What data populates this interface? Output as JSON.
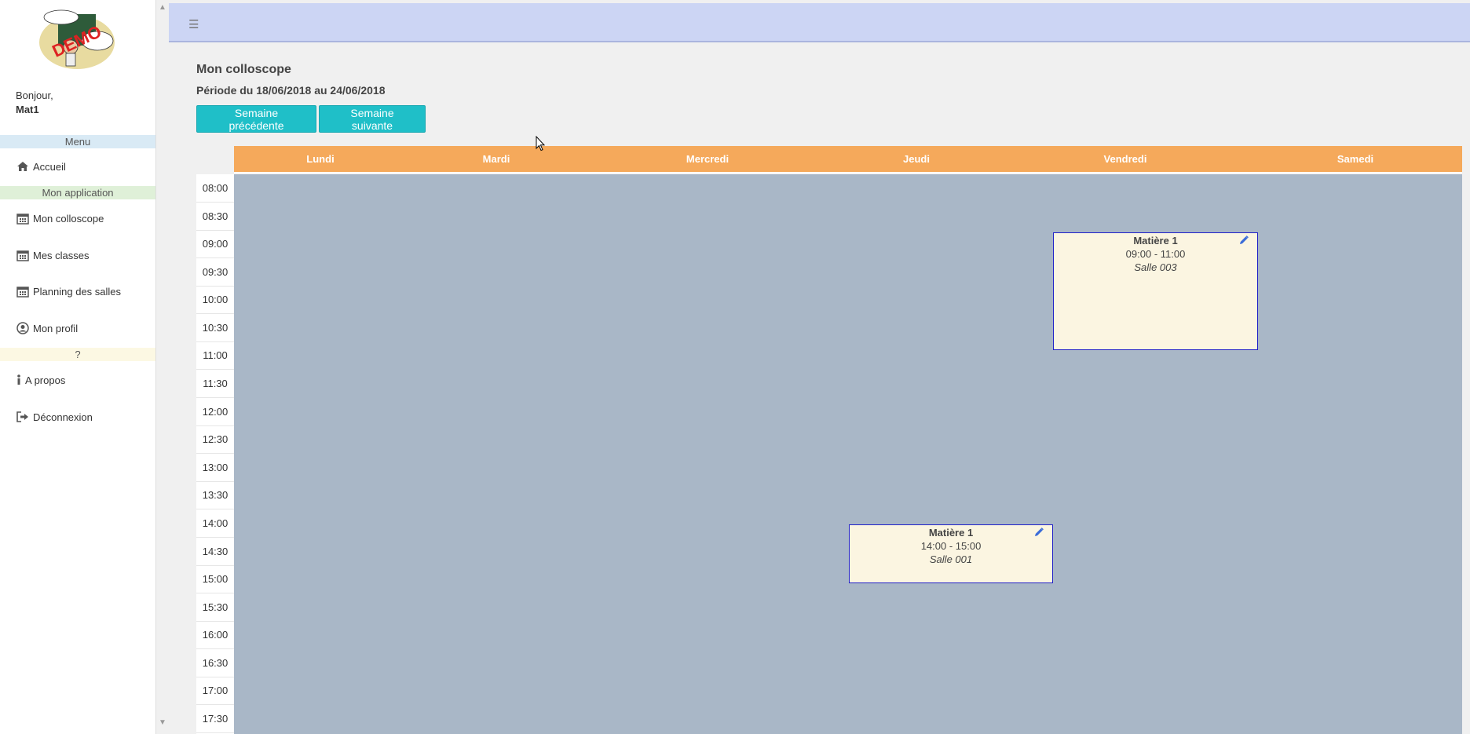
{
  "sidebar": {
    "logo_text": "DEMO",
    "greeting": "Bonjour,",
    "user": "Mat1",
    "section_menu": "Menu",
    "section_app": "Mon application",
    "section_help": "?",
    "items": {
      "accueil": "Accueil",
      "colloscope": "Mon colloscope",
      "classes": "Mes classes",
      "salles": "Planning des salles",
      "profil": "Mon profil",
      "apropos": "A propos",
      "deconnexion": "Déconnexion"
    },
    "colors": {
      "menu_bg": "#d9eaf5",
      "app_bg": "#dff0d8",
      "help_bg": "#fcf8e3"
    }
  },
  "main": {
    "title": "Mon colloscope",
    "period": "Période du 18/06/2018 au 24/06/2018",
    "prev_week": "Semaine précédente",
    "next_week": "Semaine suivante"
  },
  "calendar": {
    "days": [
      "Lundi",
      "Mardi",
      "Mercredi",
      "Jeudi",
      "Vendredi",
      "Samedi"
    ],
    "times": [
      "08:00",
      "08:30",
      "09:00",
      "09:30",
      "10:00",
      "10:30",
      "11:00",
      "11:30",
      "12:00",
      "12:30",
      "13:00",
      "13:30",
      "14:00",
      "14:30",
      "15:00",
      "15:30",
      "16:00",
      "16:30",
      "17:00",
      "17:30"
    ],
    "events": [
      {
        "title": "Matière 1",
        "time": "09:00 - 11:00",
        "room": "Salle 003"
      },
      {
        "title": "Matière 1",
        "time": "14:00 - 15:00",
        "room": "Salle 001"
      }
    ],
    "colors": {
      "header": "#f5a95b",
      "body": "#a9b7c7",
      "event_bg": "#fbf5e1",
      "event_border": "#2020c8"
    }
  }
}
